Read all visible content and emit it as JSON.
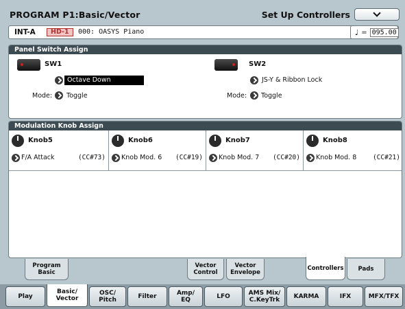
{
  "header": {
    "title": "PROGRAM P1:Basic/Vector",
    "menu_label": "Set Up Controllers"
  },
  "program": {
    "bank": "INT-A",
    "badge": "HD-1",
    "name": "000: OASYS Piano",
    "tempo_label": "=",
    "tempo_value": "095.00"
  },
  "panel_switch": {
    "heading": "Panel Switch Assign",
    "mode_label": "Mode:",
    "switches": [
      {
        "title": "SW1",
        "function": "Octave Down",
        "mode": "Toggle"
      },
      {
        "title": "SW2",
        "function": "JS-Y & Ribbon Lock",
        "mode": "Toggle"
      }
    ]
  },
  "knob_assign": {
    "heading": "Modulation Knob Assign",
    "knobs": [
      {
        "title": "Knob5",
        "function": "F/A Attack",
        "cc": "(CC#73)"
      },
      {
        "title": "Knob6",
        "function": "Knob Mod. 6",
        "cc": "(CC#19)"
      },
      {
        "title": "Knob7",
        "function": "Knob Mod. 7",
        "cc": "(CC#20)"
      },
      {
        "title": "Knob8",
        "function": "Knob Mod. 8",
        "cc": "(CC#21)"
      }
    ]
  },
  "page_tabs": [
    {
      "label": "Program\nBasic",
      "active": false
    },
    {
      "label": "Vector\nControl",
      "active": false
    },
    {
      "label": "Vector\nEnvelope",
      "active": false
    },
    {
      "label": "Controllers",
      "active": true
    },
    {
      "label": "Pads",
      "active": false
    }
  ],
  "main_tabs": [
    {
      "label": "Play",
      "active": false
    },
    {
      "label": "Basic/\nVector",
      "active": true
    },
    {
      "label": "OSC/\nPitch",
      "active": false
    },
    {
      "label": "Filter",
      "active": false
    },
    {
      "label": "Amp/\nEQ",
      "active": false
    },
    {
      "label": "LFO",
      "active": false
    },
    {
      "label": "AMS Mix/\nC.KeyTrk",
      "active": false
    },
    {
      "label": "KARMA",
      "active": false
    },
    {
      "label": "IFX",
      "active": false
    },
    {
      "label": "MFX/TFX",
      "active": false
    }
  ]
}
